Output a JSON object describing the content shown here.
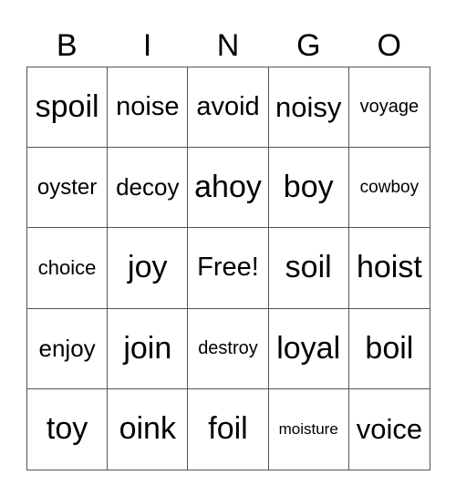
{
  "header": {
    "letters": [
      "B",
      "I",
      "N",
      "G",
      "O"
    ]
  },
  "grid": {
    "rows": [
      [
        "spoil",
        "noise",
        "avoid",
        "noisy",
        "voyage"
      ],
      [
        "oyster",
        "decoy",
        "ahoy",
        "boy",
        "cowboy"
      ],
      [
        "choice",
        "joy",
        "Free!",
        "soil",
        "hoist"
      ],
      [
        "enjoy",
        "join",
        "destroy",
        "loyal",
        "boil"
      ],
      [
        "toy",
        "oink",
        "foil",
        "moisture",
        "voice"
      ]
    ]
  }
}
